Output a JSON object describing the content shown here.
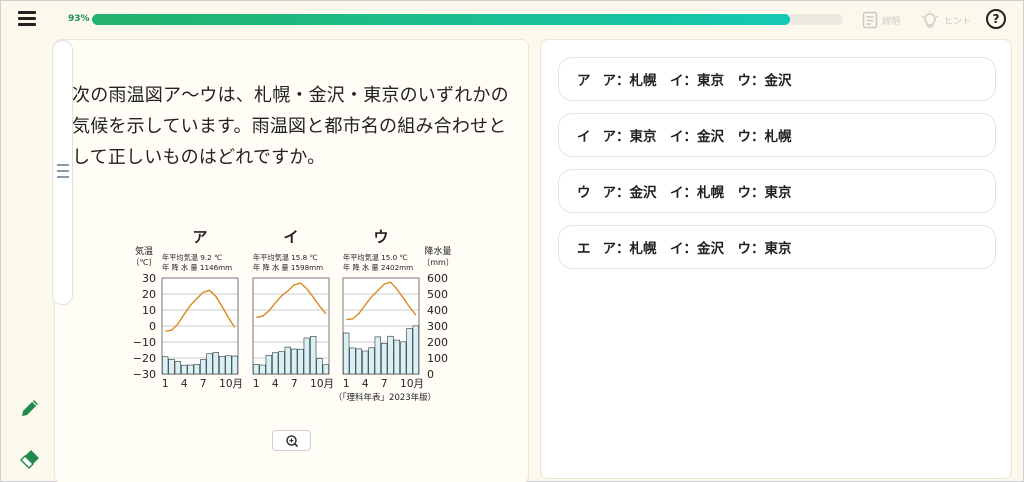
{
  "toolbar": {
    "progress_text": "93%",
    "progress_value": 0.93,
    "hint_explain_label": "説明",
    "hint_label": "ヒント",
    "help_label": "?"
  },
  "question": {
    "text": "次の雨温図ア～ウは、札幌・金沢・東京のいずれかの気候を示しています。雨温図と都市名の組み合わせとして正しいものはどれですか。"
  },
  "figure": {
    "left_axis_title_1": "気温",
    "left_axis_title_2": "〔℃〕",
    "right_axis_title_1": "降水量",
    "right_axis_title_2": "〔mm〕",
    "left_ticks": [
      "30",
      "20",
      "10",
      "0",
      "−10",
      "−20",
      "−30"
    ],
    "right_ticks": [
      "600",
      "500",
      "400",
      "300",
      "200",
      "100",
      "0"
    ],
    "x_ticks": [
      "1",
      "4",
      "7",
      "10月"
    ],
    "source": "（「理科年表」2023年版）"
  },
  "chart_data": [
    {
      "type": "bar+line",
      "title": "ア",
      "caption_1": "年平均気温 9.2 ℃",
      "caption_2": "年 降 水 量 1146mm",
      "x": [
        1,
        2,
        3,
        4,
        5,
        6,
        7,
        8,
        9,
        10,
        11,
        12
      ],
      "temperature_c": [
        -3.2,
        -2.7,
        1.1,
        7.3,
        13.0,
        17.0,
        21.1,
        22.3,
        18.6,
        12.1,
        5.2,
        -0.9
      ],
      "precipitation_mm": [
        108,
        92,
        78,
        55,
        56,
        60,
        90,
        127,
        135,
        110,
        114,
        112
      ],
      "ylim_temp": [
        -30,
        30
      ],
      "ylim_precip": [
        0,
        600
      ]
    },
    {
      "type": "bar+line",
      "title": "イ",
      "caption_1": "年平均気温 15.8 ℃",
      "caption_2": "年 降 水 量 1598mm",
      "x": [
        1,
        2,
        3,
        4,
        5,
        6,
        7,
        8,
        9,
        10,
        11,
        12
      ],
      "temperature_c": [
        5.4,
        6.1,
        9.4,
        14.3,
        18.8,
        21.9,
        25.7,
        26.9,
        23.3,
        18.0,
        12.5,
        7.7
      ],
      "precipitation_mm": [
        60,
        56,
        117,
        133,
        140,
        168,
        156,
        155,
        225,
        235,
        96,
        58
      ],
      "ylim_temp": [
        -30,
        30
      ],
      "ylim_precip": [
        0,
        600
      ]
    },
    {
      "type": "bar+line",
      "title": "ウ",
      "caption_1": "年平均気温 15.0 ℃",
      "caption_2": "年 降 水 量 2402mm",
      "x": [
        1,
        2,
        3,
        4,
        5,
        6,
        7,
        8,
        9,
        10,
        11,
        12
      ],
      "temperature_c": [
        4.0,
        4.4,
        7.7,
        13.1,
        18.1,
        22.1,
        26.2,
        27.4,
        23.2,
        17.6,
        11.9,
        6.8
      ],
      "precipitation_mm": [
        256,
        163,
        157,
        144,
        164,
        232,
        192,
        236,
        212,
        201,
        284,
        301
      ],
      "ylim_temp": [
        -30,
        30
      ],
      "ylim_precip": [
        0,
        600
      ]
    }
  ],
  "choices": [
    {
      "label": "ア",
      "text": "ア：札幌　イ：東京　ウ：金沢"
    },
    {
      "label": "イ",
      "text": "ア：東京　イ：金沢　ウ：札幌"
    },
    {
      "label": "ウ",
      "text": "ア：金沢　イ：札幌　ウ：東京"
    },
    {
      "label": "エ",
      "text": "ア：札幌　イ：金沢　ウ：東京"
    }
  ],
  "colors": {
    "progress_start": "#22b26a",
    "progress_end": "#14c9b4",
    "temp_line": "#d98a1c",
    "precip_bar": "#d7f1f7",
    "tool_green": "#1f8a4c"
  },
  "icons": {
    "menu": "menu-icon",
    "explain": "document-icon",
    "hint": "lightbulb-icon",
    "help": "question-circle-icon",
    "pencil": "pencil-icon",
    "eraser": "eraser-icon",
    "zoom": "zoom-in-icon"
  }
}
